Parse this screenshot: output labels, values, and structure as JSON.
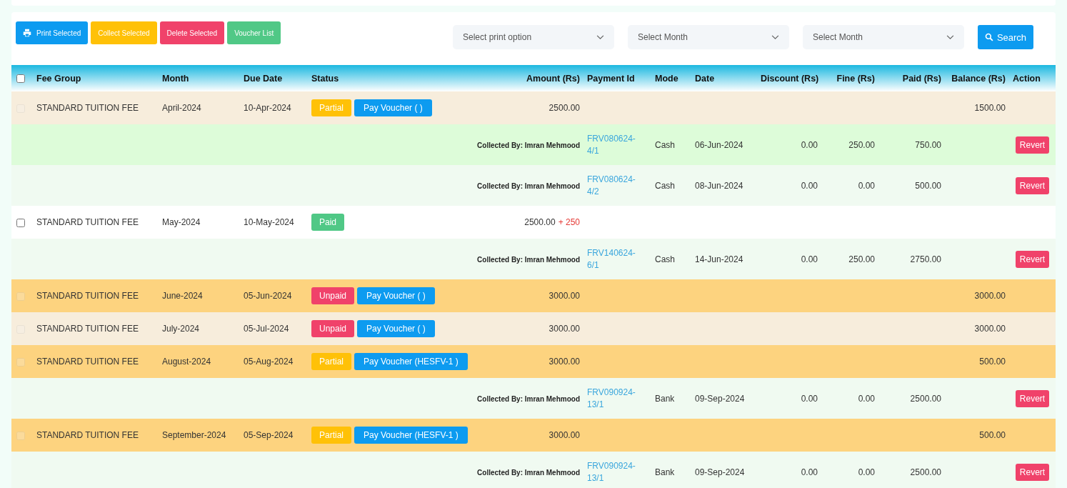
{
  "toolbar": {
    "buttons": [
      {
        "label": "Print Selected",
        "kind": "print"
      },
      {
        "label": "Collect Selected",
        "kind": "collect"
      },
      {
        "label": "Delete Selected",
        "kind": "delete"
      },
      {
        "label": "Voucher List",
        "kind": "voucher"
      }
    ],
    "selects": [
      {
        "placeholder": "Select print option"
      },
      {
        "placeholder": "Select Month"
      },
      {
        "placeholder": "Select Month"
      }
    ],
    "search_button": "Search"
  },
  "table": {
    "header_checkbox": {
      "checked": false
    },
    "columns": [
      "Fee Group",
      "Month",
      "Due Date",
      "Status",
      "Amount (Rs)",
      "Payment Id",
      "Mode",
      "Date",
      "Discount (Rs)",
      "Fine (Rs)",
      "Paid (Rs)",
      "Balance (Rs)",
      "Action"
    ],
    "rows": [
      {
        "kind": "fee",
        "color": "#f7eddc",
        "checkbox": {
          "checked": false,
          "disabled": true
        },
        "fee_group": "STANDARD TUITION FEE",
        "month": "April-2024",
        "due_date": "10-Apr-2024",
        "status": {
          "label": "Partial",
          "kind": "partial"
        },
        "voucher_button": "Pay Voucher ( )",
        "amount": "2500.00",
        "balance": "1500.00"
      },
      {
        "kind": "payment",
        "color": "#ddfcd9",
        "collected_by": "Collected By: Imran Mehmood",
        "payment_id": "FRV080624-4/1",
        "mode": "Cash",
        "date": "06-Jun-2024",
        "discount": "0.00",
        "fine": "250.00",
        "paid": "750.00",
        "action": "Revert"
      },
      {
        "kind": "payment",
        "color": "#f0faf1",
        "collected_by": "Collected By: Imran Mehmood",
        "payment_id": "FRV080624-4/2",
        "mode": "Cash",
        "date": "08-Jun-2024",
        "discount": "0.00",
        "fine": "0.00",
        "paid": "500.00",
        "action": "Revert"
      },
      {
        "kind": "fee",
        "color": "#ffffff",
        "checkbox": {
          "checked": false,
          "disabled": false
        },
        "fee_group": "STANDARD TUITION FEE",
        "month": "May-2024",
        "due_date": "10-May-2024",
        "status": {
          "label": "Paid",
          "kind": "paid"
        },
        "amount": "2500.00",
        "amount_extra": "+ 250"
      },
      {
        "kind": "payment",
        "color": "#f0faf1",
        "collected_by": "Collected By: Imran Mehmood",
        "payment_id": "FRV140624-6/1",
        "mode": "Cash",
        "date": "14-Jun-2024",
        "discount": "0.00",
        "fine": "250.00",
        "paid": "2750.00",
        "action": "Revert"
      },
      {
        "kind": "fee",
        "color": "#fdd37f",
        "checkbox": {
          "checked": false,
          "disabled": true
        },
        "fee_group": "STANDARD TUITION FEE",
        "month": "June-2024",
        "due_date": "05-Jun-2024",
        "status": {
          "label": "Unpaid",
          "kind": "unpaid"
        },
        "voucher_button": "Pay Voucher ( )",
        "amount": "3000.00",
        "balance": "3000.00"
      },
      {
        "kind": "fee",
        "color": "#f7eddc",
        "checkbox": {
          "checked": false,
          "disabled": true
        },
        "fee_group": "STANDARD TUITION FEE",
        "month": "July-2024",
        "due_date": "05-Jul-2024",
        "status": {
          "label": "Unpaid",
          "kind": "unpaid"
        },
        "voucher_button": "Pay Voucher ( )",
        "amount": "3000.00",
        "balance": "3000.00"
      },
      {
        "kind": "fee",
        "color": "#fdd37f",
        "checkbox": {
          "checked": false,
          "disabled": true
        },
        "fee_group": "STANDARD TUITION FEE",
        "month": "August-2024",
        "due_date": "05-Aug-2024",
        "status": {
          "label": "Partial",
          "kind": "partial"
        },
        "voucher_button": "Pay Voucher (HESFV-1 )",
        "amount": "3000.00",
        "balance": "500.00"
      },
      {
        "kind": "payment",
        "color": "#f0faf1",
        "collected_by": "Collected By: Imran Mehmood",
        "payment_id": "FRV090924-13/1",
        "mode": "Bank",
        "date": "09-Sep-2024",
        "discount": "0.00",
        "fine": "0.00",
        "paid": "2500.00",
        "action": "Revert"
      },
      {
        "kind": "fee",
        "color": "#fdd37f",
        "checkbox": {
          "checked": false,
          "disabled": true
        },
        "fee_group": "STANDARD TUITION FEE",
        "month": "September-2024",
        "due_date": "05-Sep-2024",
        "status": {
          "label": "Partial",
          "kind": "partial"
        },
        "voucher_button": "Pay Voucher (HESFV-1 )",
        "amount": "3000.00",
        "balance": "500.00"
      },
      {
        "kind": "payment",
        "color": "#f0faf1",
        "collected_by": "Collected By: Imran Mehmood",
        "payment_id": "FRV090924-13/1",
        "mode": "Bank",
        "date": "09-Sep-2024",
        "discount": "0.00",
        "fine": "0.00",
        "paid": "2500.00",
        "action": "Revert"
      }
    ]
  }
}
